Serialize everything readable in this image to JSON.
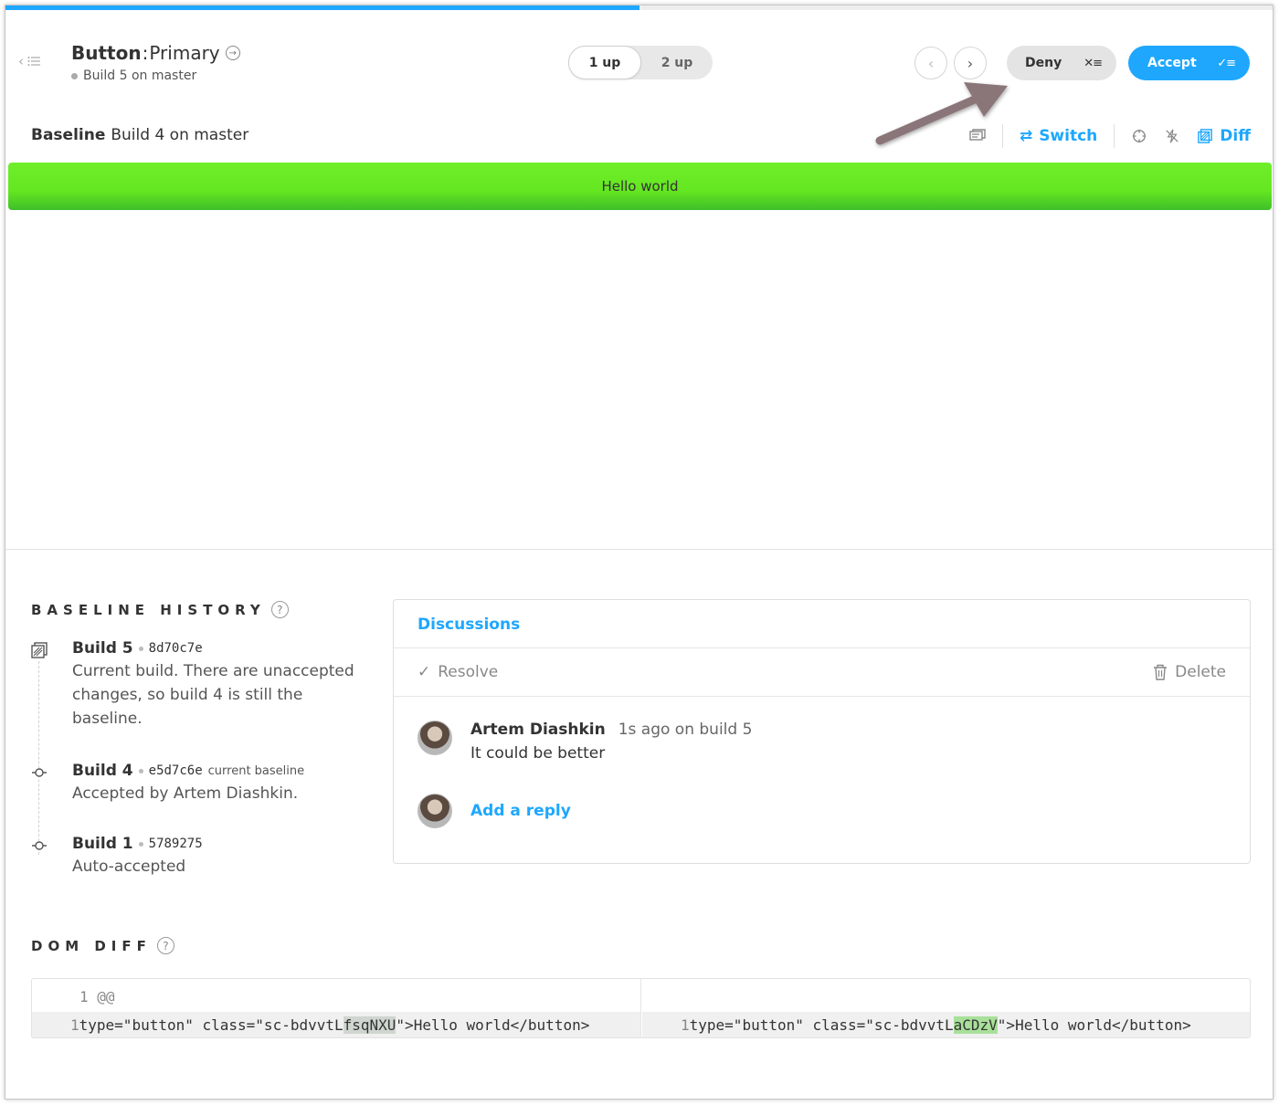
{
  "header": {
    "progress_percent": 50,
    "component": "Button",
    "story": "Primary",
    "build_info": "Build 5 on master",
    "view_toggle": [
      "1 up",
      "2 up"
    ],
    "view_active": "1 up",
    "deny_label": "Deny",
    "accept_label": "Accept"
  },
  "baseline_bar": {
    "label": "Baseline",
    "value": "Build 4 on master",
    "switch_label": "Switch",
    "diff_label": "Diff"
  },
  "preview": {
    "button_text": "Hello world",
    "button_color": "#66e822"
  },
  "history": {
    "title": "BASELINE HISTORY",
    "items": [
      {
        "build": "Build 5",
        "hash": "8d70c7e",
        "tag": "",
        "desc": "Current build. There are unaccepted changes, so build 4 is still the baseline."
      },
      {
        "build": "Build 4",
        "hash": "e5d7c6e",
        "tag": "current baseline",
        "desc": "Accepted by Artem Diashkin."
      },
      {
        "build": "Build 1",
        "hash": "5789275",
        "tag": "",
        "desc": "Auto-accepted"
      }
    ]
  },
  "discussions": {
    "title": "Discussions",
    "resolve_label": "Resolve",
    "delete_label": "Delete",
    "comment": {
      "author": "Artem Diashkin",
      "meta": "1s ago on build 5",
      "text": "It could be better"
    },
    "reply_label": "Add a reply"
  },
  "dom_diff": {
    "title": "DOM DIFF",
    "hunk_num": "1",
    "hunk_marker": "@@",
    "left": {
      "num": "1",
      "pre": "type=\"button\" class=\"sc-bdvvtL ",
      "hl": "fsqNXU",
      "post": "\">Hello world</button>"
    },
    "right": {
      "num": "1",
      "pre": "type=\"button\" class=\"sc-bdvvtL ",
      "hl": "aCDzV",
      "post": "\">Hello world</button>"
    }
  },
  "colors": {
    "accent": "#1ea7fd",
    "deny_bg": "#e4e4e4",
    "arrow": "#8a7478"
  }
}
